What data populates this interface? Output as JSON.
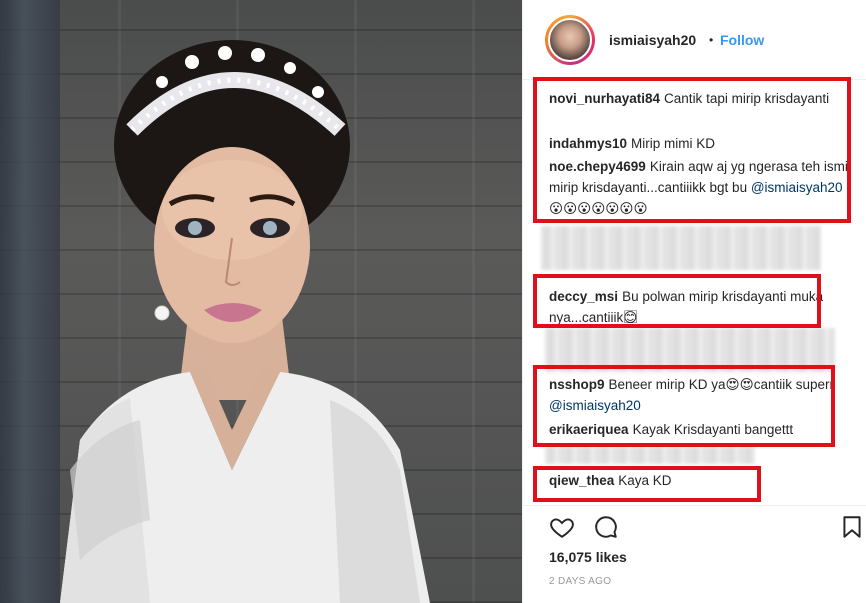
{
  "post": {
    "username": "ismiaisyah20",
    "separator": "•",
    "follow_label": "Follow"
  },
  "comments": [
    {
      "user": "novi_nurhayati84",
      "text": "Cantik tapi mirip krisdayanti"
    },
    {
      "user": "indahmys10",
      "text": "Mirip mimi KD"
    },
    {
      "user": "noe.chepy4699",
      "text": "Kirain aqw aj yg ngerasa teh ismi mirip krisdayanti...cantiiikk bgt bu ",
      "mention": "@ismiaisyah20",
      "suffix": " 😮😮😮😮😮😮😮"
    },
    {
      "user": "deccy_msi",
      "text": "Bu polwan mirip krisdayanti muka nya...cantiiik😊⃞"
    },
    {
      "user": "nsshop9",
      "text": "Beneer mirip KD ya😍😍cantiik superr ",
      "mention": "@ismiaisyah20"
    },
    {
      "user": "erikaeriquea",
      "text": "Kayak Krisdayanti bangettt"
    },
    {
      "user": "qiew_thea",
      "text": "Kaya KD"
    }
  ],
  "likes": "16,075 likes",
  "time_ago": "2 DAYS AGO",
  "icons": [
    "heart-icon",
    "comment-icon",
    "bookmark-icon"
  ],
  "colors": {
    "highlight": "#e0101a",
    "link": "#3897f0",
    "mention": "#003569"
  }
}
